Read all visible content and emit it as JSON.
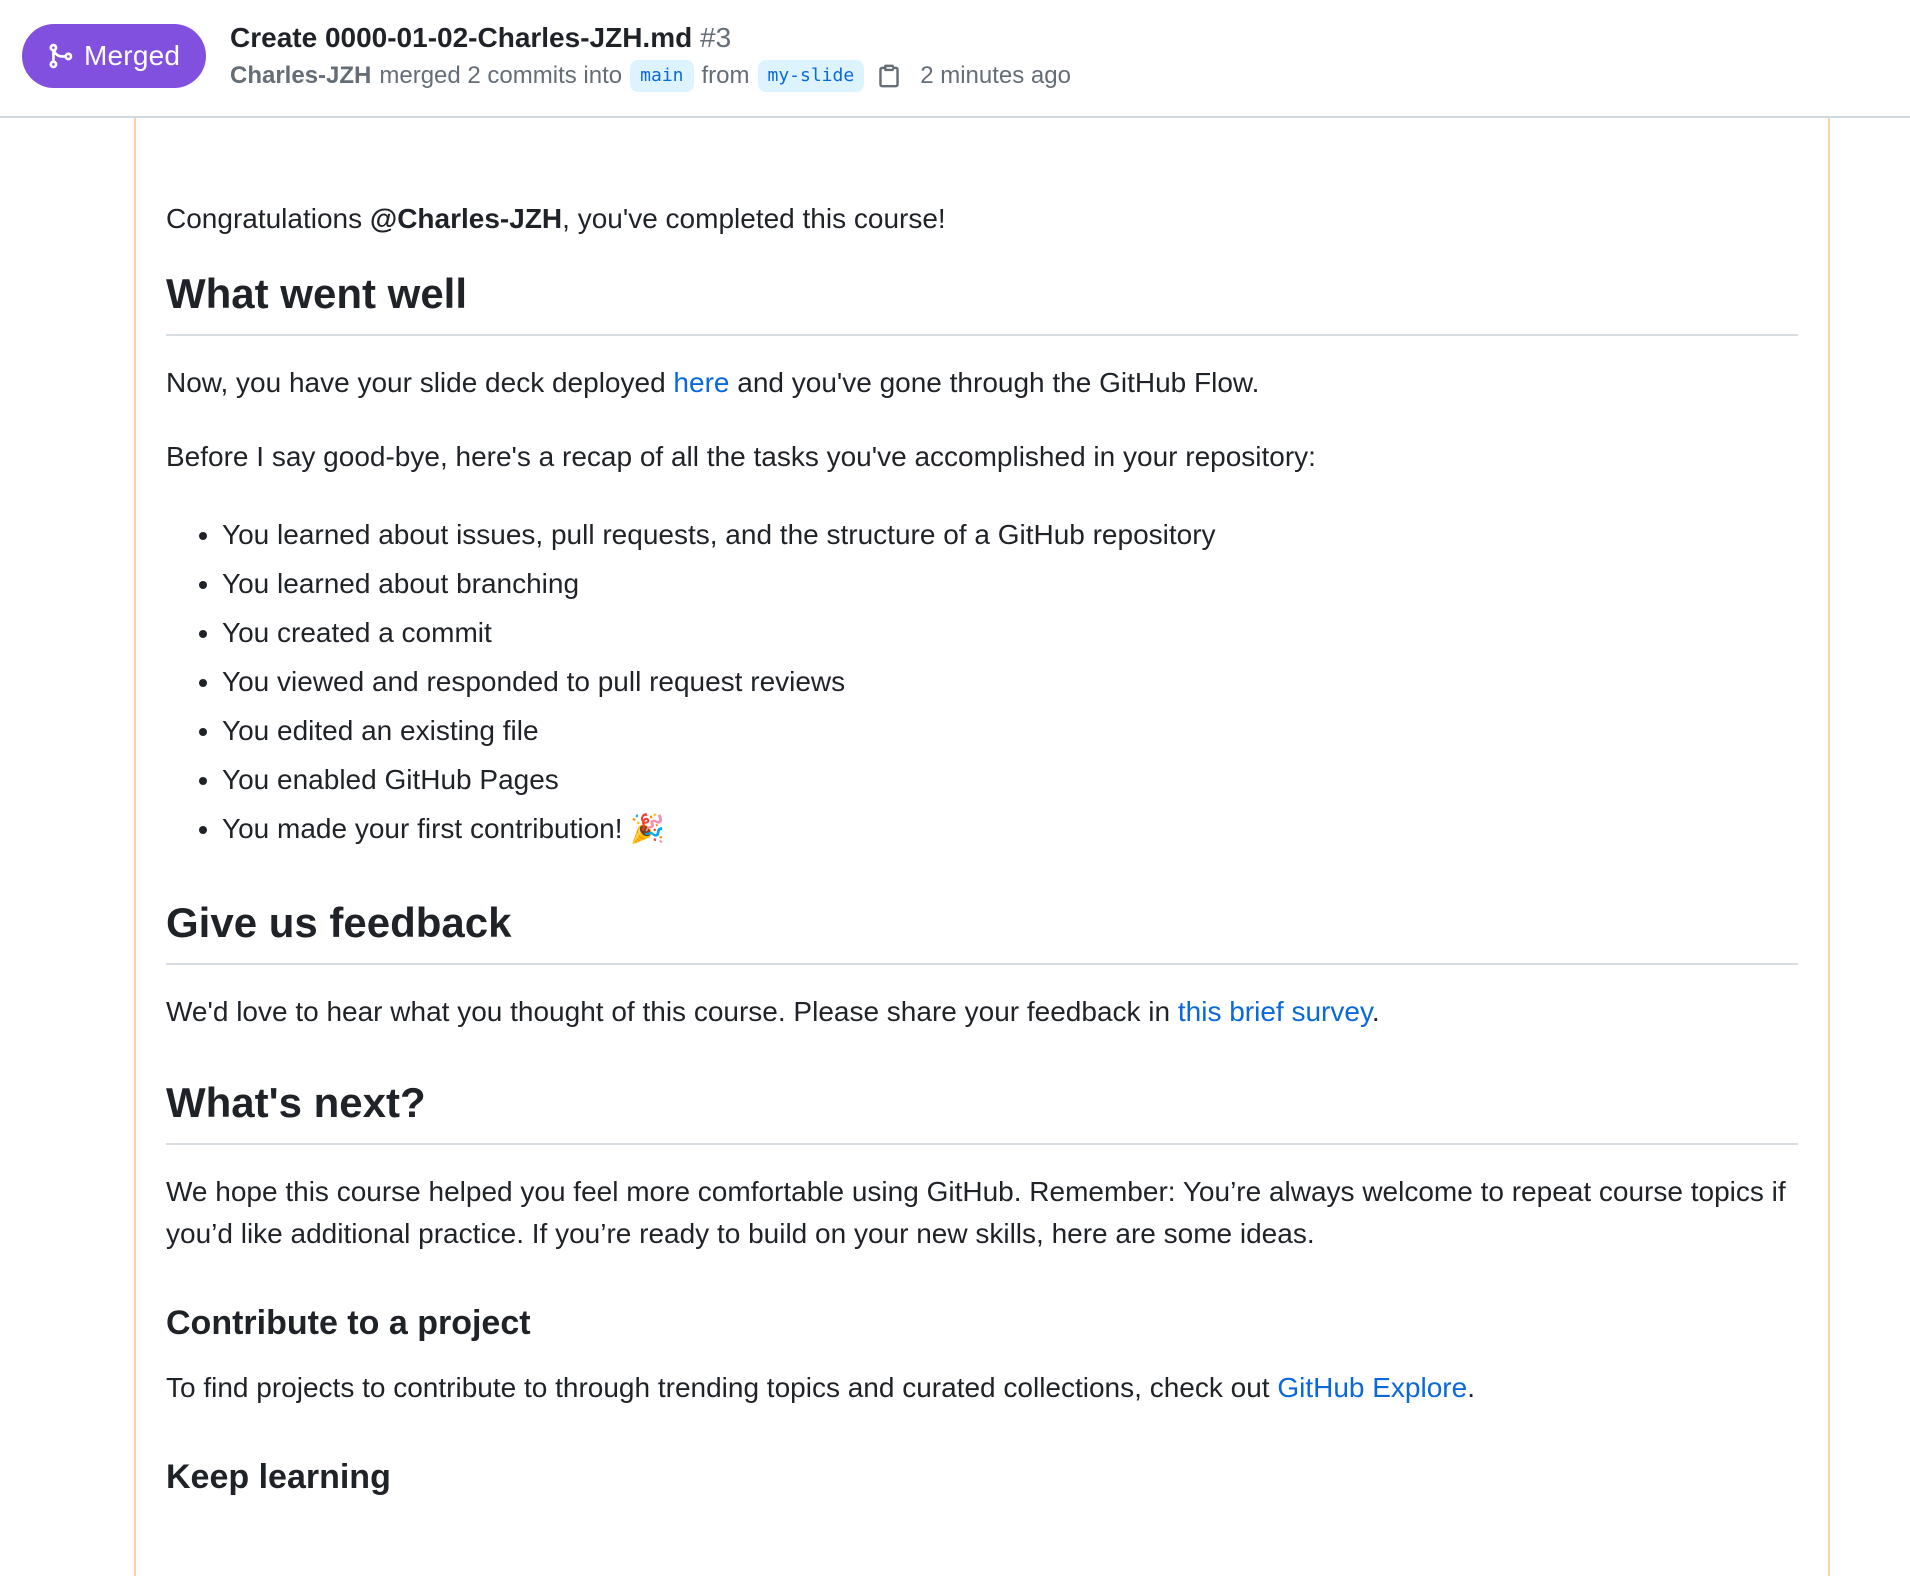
{
  "header": {
    "state": "Merged",
    "title": "Create 0000-01-02-Charles-JZH.md",
    "number": "#3",
    "author": "Charles-JZH",
    "action": "merged 2 commits into",
    "base_branch": "main",
    "from_text": "from",
    "head_branch": "my-slide",
    "time": "2 minutes ago",
    "colors": {
      "merged_badge": "#8250df",
      "link": "#0969da",
      "branch_bg": "#ddf4ff"
    },
    "icons": {
      "state": "git-merge-icon",
      "copy": "copy-icon"
    }
  },
  "comment": {
    "congrats_before": "Congratulations ",
    "congrats_user": "@Charles-JZH",
    "congrats_after": ", you've completed this course!",
    "section1_heading": "What went well",
    "deployed_before": "Now, you have your slide deck deployed ",
    "deployed_link": "here",
    "deployed_after": " and you've gone through the GitHub Flow.",
    "recap_intro": "Before I say good-bye, here's a recap of all the tasks you've accomplished in your repository:",
    "recap_items": [
      "You learned about issues, pull requests, and the structure of a GitHub repository",
      "You learned about branching",
      "You created a commit",
      "You viewed and responded to pull request reviews",
      "You edited an existing file",
      "You enabled GitHub Pages",
      "You made your first contribution! 🎉"
    ],
    "section2_heading": "Give us feedback",
    "feedback_before": "We'd love to hear what you thought of this course. Please share your feedback in ",
    "feedback_link": "this brief survey",
    "feedback_after": ".",
    "section3_heading": "What's next?",
    "next_paragraph": "We hope this course helped you feel more comfortable using GitHub. Remember: You’re always welcome to repeat course topics if you’d like additional practice. If you’re ready to build on your new skills, here are some ideas.",
    "subsection1_heading": "Contribute to a project",
    "contribute_before": "To find projects to contribute to through trending topics and curated collections, check out ",
    "contribute_link": "GitHub Explore",
    "contribute_after": ".",
    "subsection2_heading": "Keep learning"
  }
}
